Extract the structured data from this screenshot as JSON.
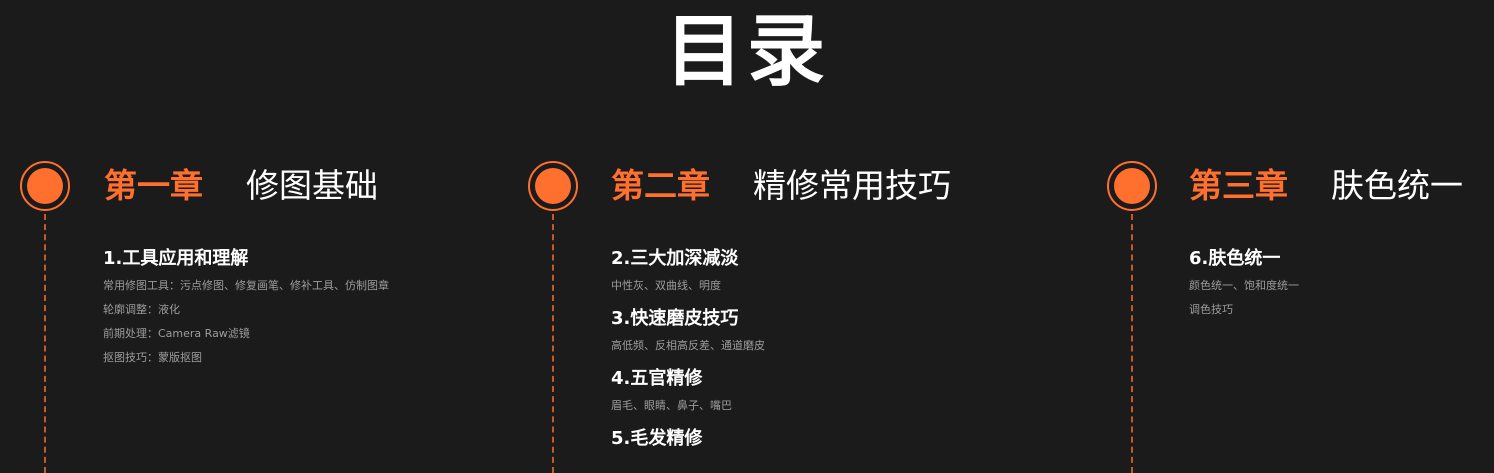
{
  "title": "目录",
  "accent_color": "#ff6f2e",
  "background_color": "#1b1b1b",
  "chapters": [
    {
      "number": "第一章",
      "name": "修图基础",
      "sections": [
        {
          "title": "1.工具应用和理解",
          "lines": [
            "常用修图工具：污点修图、修复画笔、修补工具、仿制图章",
            "轮廓调整：液化",
            "前期处理：Camera Raw滤镜",
            "抠图技巧：蒙版抠图"
          ]
        }
      ]
    },
    {
      "number": "第二章",
      "name": "精修常用技巧",
      "sections": [
        {
          "title": "2.三大加深减淡",
          "lines": [
            "中性灰、双曲线、明度"
          ]
        },
        {
          "title": "3.快速磨皮技巧",
          "lines": [
            "高低频、反相高反差、通道磨皮"
          ]
        },
        {
          "title": "4.五官精修",
          "lines": [
            "眉毛、眼睛、鼻子、嘴巴"
          ]
        },
        {
          "title": "5.毛发精修",
          "lines": []
        }
      ]
    },
    {
      "number": "第三章",
      "name": "肤色统一",
      "sections": [
        {
          "title": "6.肤色统一",
          "lines": [
            "颜色统一、饱和度统一",
            "调色技巧"
          ]
        }
      ]
    }
  ]
}
